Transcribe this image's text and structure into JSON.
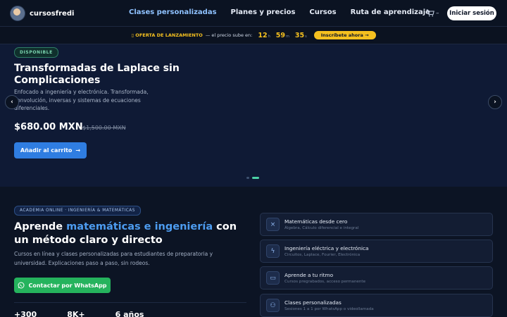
{
  "header": {
    "logo_text": "cursosfredi",
    "nav": [
      {
        "label": "Clases personalizadas",
        "active": true
      },
      {
        "label": "Planes y precios",
        "active": false
      },
      {
        "label": "Cursos",
        "active": false
      },
      {
        "label": "Ruta de aprendizaje",
        "active": false
      }
    ],
    "cart_count": "–",
    "login_label": "Iniciar sesión"
  },
  "promo": {
    "flag": "OFERTA DE LANZAMIENTO",
    "desc": "— el precio sube en:",
    "countdown": [
      {
        "value": "12",
        "unit": "h"
      },
      {
        "value": "59",
        "unit": "m"
      },
      {
        "value": "35",
        "unit": "s"
      }
    ],
    "cta": "Inscríbete ahora →"
  },
  "hero": {
    "badge": "DISPONIBLE",
    "title": "Transformadas de Laplace sin Complicaciones",
    "description": "Enfocado a ingeniería y electrónica. Transformada, convolución, inversas y sistemas de ecuaciones diferenciales.",
    "price": "$680.00 MXN",
    "old_price": "$1,500.00 MXN",
    "add_to_cart": "Añadir al carrito",
    "slides_total": 2,
    "active_slide": 2
  },
  "intro": {
    "tag": "ACADEMIA ONLINE · INGENIERÍA & MATEMÁTICAS",
    "title_pre": "Aprende ",
    "title_highlight": "matemáticas e ingeniería",
    "title_post": " con un método claro y directo",
    "description": "Cursos en línea y clases personalizadas para estudiantes de preparatoria y universidad. Explicaciones paso a paso, sin rodeos.",
    "whatsapp_cta": "Contactar por WhatsApp",
    "stats": [
      "+300",
      "8K+",
      "6 años"
    ]
  },
  "features": [
    {
      "icon": "math-icon",
      "title": "Matemáticas desde cero",
      "subtitle": "Álgebra, Cálculo diferencial e integral"
    },
    {
      "icon": "lightning-icon",
      "title": "Ingeniería eléctrica y electrónica",
      "subtitle": "Circuitos, Laplace, Fourier, Electrónica"
    },
    {
      "icon": "monitor-icon",
      "title": "Aprende a tu ritmo",
      "subtitle": "Cursos pregrabados, acceso permanente"
    },
    {
      "icon": "users-icon",
      "title": "Clases personalizadas",
      "subtitle": "Sesiones 1 a 1 por WhatsApp o videollamada"
    }
  ],
  "colors": {
    "accent": "#4d9cf0",
    "promo": "#f5c01f",
    "whatsapp": "#25b35d",
    "available": "#7bd5b0"
  }
}
